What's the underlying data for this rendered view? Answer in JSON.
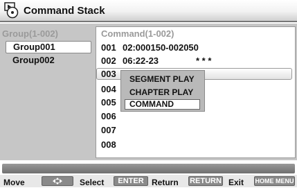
{
  "header": {
    "title": "Command Stack",
    "icon": "disc-menu-icon"
  },
  "groups": {
    "heading": "Group(1-002)",
    "items": [
      {
        "label": "Group001",
        "selected": true
      },
      {
        "label": "Group002",
        "selected": false
      }
    ]
  },
  "commands": {
    "heading": "Command(1-002)",
    "rows": [
      {
        "num": "001",
        "text": "02:000150-002050"
      },
      {
        "num": "002",
        "text": "06:22-23"
      },
      {
        "num": "003",
        "text": ""
      },
      {
        "num": "004",
        "text": ""
      },
      {
        "num": "005",
        "text": ""
      },
      {
        "num": "006",
        "text": ""
      },
      {
        "num": "007",
        "text": ""
      },
      {
        "num": "008",
        "text": ""
      }
    ],
    "row002_marks": "* * *",
    "highlighted_row": "003"
  },
  "popup": {
    "items": [
      "SEGMENT PLAY",
      "CHAPTER PLAY",
      "COMMAND"
    ],
    "selected": "COMMAND"
  },
  "footer": {
    "move_label": "Move",
    "move_key_icon": "four-way-arrow-icon",
    "select_label": "Select",
    "select_key": "ENTER",
    "return_label": "Return",
    "return_key": "RETURN",
    "exit_label": "Exit",
    "exit_key": "HOME MENU"
  }
}
